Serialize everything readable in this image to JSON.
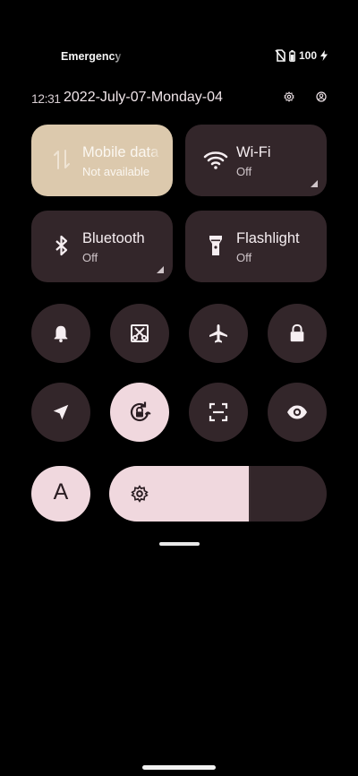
{
  "status": {
    "carrier": "Emergency calls only",
    "battery": "100"
  },
  "header": {
    "time": "12:31",
    "date": "2022-July-07-Monday-04"
  },
  "tiles": {
    "mobile": {
      "label": "Mobile data",
      "status": "Not available"
    },
    "wifi": {
      "label": "Wi-Fi",
      "status": "Off"
    },
    "bluetooth": {
      "label": "Bluetooth",
      "status": "Off"
    },
    "flashlight": {
      "label": "Flashlight",
      "status": "Off"
    }
  },
  "font_button": {
    "label": "A"
  },
  "brightness": {
    "level": 0.64
  },
  "colors": {
    "tile_bg": "#33262a",
    "tile_active": "#dcc9ad",
    "accent": "#f0d8de"
  }
}
